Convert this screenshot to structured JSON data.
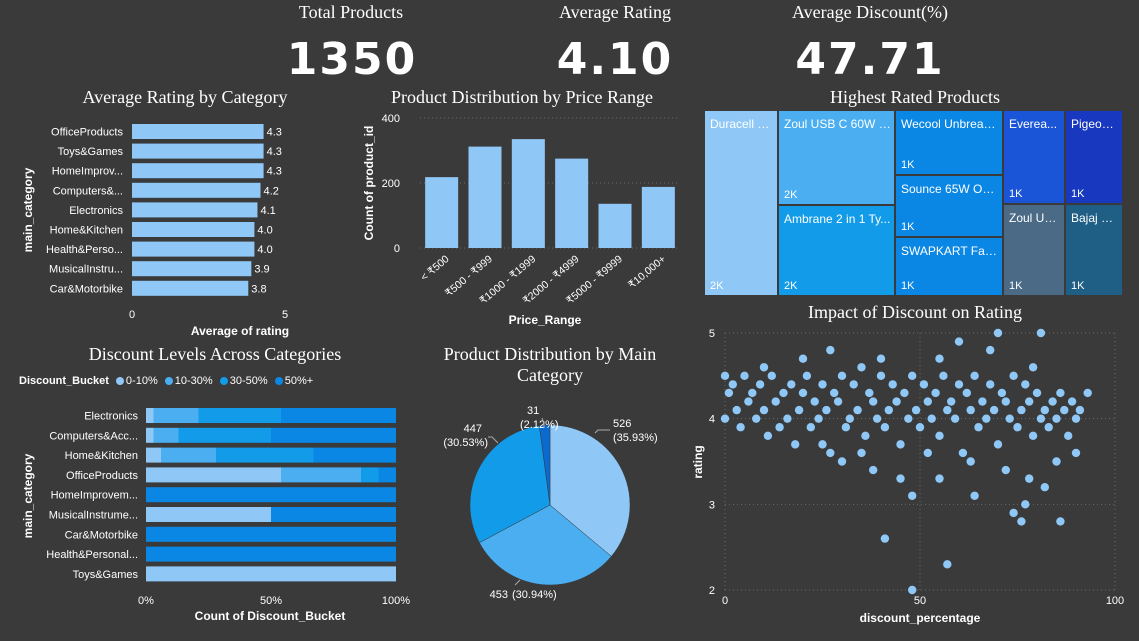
{
  "colors": {
    "background": "#3a3a3a",
    "light_blue": "#8fc8f7",
    "mid_blue": "#4aaef0",
    "blue": "#129be8",
    "deep_blue": "#0a87e4",
    "gridline": "#6a6a6a"
  },
  "kpis": [
    {
      "title": "Total Products",
      "value": "1350"
    },
    {
      "title": "Average Rating",
      "value": "4.10"
    },
    {
      "title": "Average Discount(%)",
      "value": "47.71"
    }
  ],
  "avg_rating_chart": {
    "title": "Average Rating by Category",
    "chart_data": {
      "type": "bar",
      "orientation": "horizontal",
      "categories": [
        "OfficeProducts",
        "Toys&Games",
        "HomeImprov...",
        "Computers&...",
        "Electronics",
        "Home&Kitchen",
        "Health&Perso...",
        "MusicalInstru...",
        "Car&Motorbike"
      ],
      "values": [
        4.3,
        4.3,
        4.3,
        4.2,
        4.1,
        4.0,
        4.0,
        3.9,
        3.8
      ],
      "value_labels": [
        "4.3",
        "4.3",
        "4.3",
        "4.2",
        "4.1",
        "4.0",
        "4.0",
        "3.9",
        "3.8"
      ],
      "xlabel": "Average of rating",
      "ylabel": "main_category",
      "xlim": [
        0,
        5
      ],
      "x_ticks": [
        "0",
        "5"
      ]
    }
  },
  "price_dist_chart": {
    "title": "Product Distribution by Price Range",
    "chart_data": {
      "type": "bar",
      "categories": [
        "< ₹500",
        "₹500 - ₹999",
        "₹1000 - ₹1999",
        "₹2000 - ₹4999",
        "₹5000 - ₹9999",
        "₹10,000+"
      ],
      "values": [
        218,
        312,
        335,
        275,
        136,
        188
      ],
      "xlabel": "Price_Range",
      "ylabel": "Count of product_id",
      "ylim": [
        0,
        400
      ],
      "y_ticks": [
        "0",
        "200",
        "400"
      ],
      "grid": true
    }
  },
  "treemap": {
    "title": "Highest Rated Products",
    "items": [
      {
        "label": "Duracell U...",
        "value": "2K"
      },
      {
        "label": "Zoul USB C 60W F...",
        "value": "2K"
      },
      {
        "label": "Ambrane 2 in 1 Ty...",
        "value": "2K"
      },
      {
        "label": "Wecool Unbreak...",
        "value": "1K"
      },
      {
        "label": "Sounce 65W On...",
        "value": "1K"
      },
      {
        "label": "SWAPKART Fast ...",
        "value": "1K"
      },
      {
        "label": "Everea...",
        "value": "1K"
      },
      {
        "label": "Pigeon ...",
        "value": "1K"
      },
      {
        "label": "Zoul US...",
        "value": "1K"
      },
      {
        "label": "Bajaj N...",
        "value": "1K"
      }
    ]
  },
  "discount_levels_chart": {
    "title": "Discount Levels Across Categories",
    "legend_title": "Discount_Bucket",
    "chart_data": {
      "type": "bar",
      "orientation": "horizontal",
      "stacked": "100%",
      "categories": [
        "Electronics",
        "Computers&Acc...",
        "Home&Kitchen",
        "OfficeProducts",
        "HomeImprovem...",
        "MusicalInstrume...",
        "Car&Motorbike",
        "Health&Personal...",
        "Toys&Games"
      ],
      "series": [
        {
          "name": "0-10%",
          "color": "#8fc8f7",
          "values": [
            3,
            3,
            6,
            54,
            0,
            50,
            0,
            0,
            100
          ]
        },
        {
          "name": "10-30%",
          "color": "#4aaef0",
          "values": [
            18,
            10,
            22,
            32,
            0,
            0,
            0,
            0,
            0
          ]
        },
        {
          "name": "30-50%",
          "color": "#129be8",
          "values": [
            33,
            37,
            39,
            7,
            0,
            0,
            0,
            0,
            0
          ]
        },
        {
          "name": "50%+",
          "color": "#0a87e4",
          "values": [
            46,
            50,
            33,
            7,
            100,
            50,
            100,
            100,
            0
          ]
        }
      ],
      "xlabel": "Count of Discount_Bucket",
      "ylabel": "main_category",
      "x_ticks": [
        "0%",
        "50%",
        "100%"
      ]
    }
  },
  "main_category_pie": {
    "title": "Product Distribution by Main Category",
    "chart_data": {
      "type": "pie",
      "values": [
        526,
        453,
        447,
        31
      ],
      "colors": [
        "#8fc8f7",
        "#4aaef0",
        "#129be8",
        "#0a6ad0"
      ],
      "labels": [
        {
          "count": "526",
          "pct": "(35.93%)"
        },
        {
          "count": "453",
          "pct": "(30.94%)"
        },
        {
          "count": "447",
          "pct": "(30.53%)"
        },
        {
          "count": "31",
          "pct": "(2.12%)"
        }
      ]
    }
  },
  "scatter_chart": {
    "title": "Impact of Discount on Rating",
    "chart_data": {
      "type": "scatter",
      "xlabel": "discount_percentage",
      "ylabel": "rating",
      "xlim": [
        0,
        100
      ],
      "ylim": [
        2,
        5
      ],
      "x_ticks": [
        "0",
        "50",
        "100"
      ],
      "y_ticks": [
        "2",
        "3",
        "4",
        "5"
      ],
      "grid": true,
      "points": [
        [
          0,
          4.5
        ],
        [
          0,
          4.0
        ],
        [
          1,
          4.3
        ],
        [
          2,
          4.4
        ],
        [
          3,
          4.1
        ],
        [
          4,
          3.9
        ],
        [
          5,
          4.5
        ],
        [
          6,
          4.2
        ],
        [
          7,
          4.3
        ],
        [
          8,
          4.0
        ],
        [
          9,
          4.4
        ],
        [
          10,
          4.1
        ],
        [
          11,
          3.8
        ],
        [
          12,
          4.5
        ],
        [
          13,
          4.2
        ],
        [
          14,
          3.9
        ],
        [
          15,
          4.3
        ],
        [
          16,
          4.0
        ],
        [
          17,
          4.4
        ],
        [
          18,
          3.7
        ],
        [
          19,
          4.1
        ],
        [
          20,
          4.3
        ],
        [
          21,
          4.5
        ],
        [
          22,
          3.9
        ],
        [
          23,
          4.2
        ],
        [
          24,
          4.0
        ],
        [
          25,
          4.4
        ],
        [
          26,
          4.1
        ],
        [
          27,
          3.6
        ],
        [
          28,
          4.3
        ],
        [
          29,
          4.2
        ],
        [
          30,
          4.5
        ],
        [
          31,
          3.9
        ],
        [
          32,
          4.0
        ],
        [
          33,
          4.4
        ],
        [
          34,
          4.1
        ],
        [
          35,
          4.6
        ],
        [
          36,
          3.8
        ],
        [
          37,
          4.3
        ],
        [
          38,
          4.2
        ],
        [
          39,
          4.0
        ],
        [
          40,
          4.5
        ],
        [
          41,
          3.9
        ],
        [
          42,
          4.1
        ],
        [
          43,
          4.4
        ],
        [
          44,
          4.2
        ],
        [
          45,
          3.7
        ],
        [
          46,
          4.3
        ],
        [
          47,
          4.0
        ],
        [
          48,
          4.5
        ],
        [
          49,
          4.1
        ],
        [
          50,
          3.9
        ],
        [
          51,
          4.4
        ],
        [
          52,
          4.2
        ],
        [
          53,
          4.0
        ],
        [
          54,
          4.3
        ],
        [
          55,
          3.8
        ],
        [
          56,
          4.5
        ],
        [
          57,
          4.1
        ],
        [
          58,
          4.2
        ],
        [
          59,
          4.0
        ],
        [
          60,
          4.4
        ],
        [
          61,
          3.6
        ],
        [
          62,
          4.3
        ],
        [
          63,
          4.1
        ],
        [
          64,
          4.5
        ],
        [
          65,
          3.9
        ],
        [
          66,
          4.2
        ],
        [
          67,
          4.0
        ],
        [
          68,
          4.4
        ],
        [
          69,
          4.1
        ],
        [
          70,
          3.7
        ],
        [
          71,
          4.3
        ],
        [
          72,
          4.2
        ],
        [
          73,
          4.0
        ],
        [
          74,
          4.5
        ],
        [
          75,
          3.9
        ],
        [
          76,
          4.1
        ],
        [
          77,
          4.4
        ],
        [
          78,
          4.2
        ],
        [
          79,
          3.8
        ],
        [
          80,
          4.3
        ],
        [
          81,
          4.0
        ],
        [
          82,
          4.1
        ],
        [
          83,
          3.9
        ],
        [
          84,
          4.2
        ],
        [
          85,
          4.0
        ],
        [
          86,
          4.3
        ],
        [
          87,
          4.1
        ],
        [
          88,
          3.8
        ],
        [
          89,
          4.2
        ],
        [
          90,
          4.0
        ],
        [
          91,
          4.1
        ],
        [
          93,
          4.3
        ],
        [
          10,
          4.6
        ],
        [
          20,
          4.7
        ],
        [
          27,
          4.8
        ],
        [
          40,
          4.7
        ],
        [
          55,
          4.7
        ],
        [
          68,
          4.8
        ],
        [
          70,
          5.0
        ],
        [
          79,
          4.6
        ],
        [
          81,
          5.0
        ],
        [
          60,
          4.9
        ],
        [
          30,
          3.5
        ],
        [
          38,
          3.4
        ],
        [
          45,
          3.3
        ],
        [
          52,
          3.6
        ],
        [
          63,
          3.5
        ],
        [
          72,
          3.4
        ],
        [
          78,
          3.3
        ],
        [
          82,
          3.2
        ],
        [
          85,
          3.5
        ],
        [
          90,
          3.6
        ],
        [
          74,
          2.9
        ],
        [
          77,
          3.0
        ],
        [
          76,
          2.8
        ],
        [
          86,
          2.8
        ],
        [
          41,
          2.6
        ],
        [
          48,
          3.1
        ],
        [
          64,
          3.1
        ],
        [
          55,
          3.3
        ],
        [
          35,
          3.6
        ],
        [
          25,
          3.7
        ],
        [
          57,
          2.3
        ],
        [
          48,
          2.0
        ]
      ]
    }
  }
}
